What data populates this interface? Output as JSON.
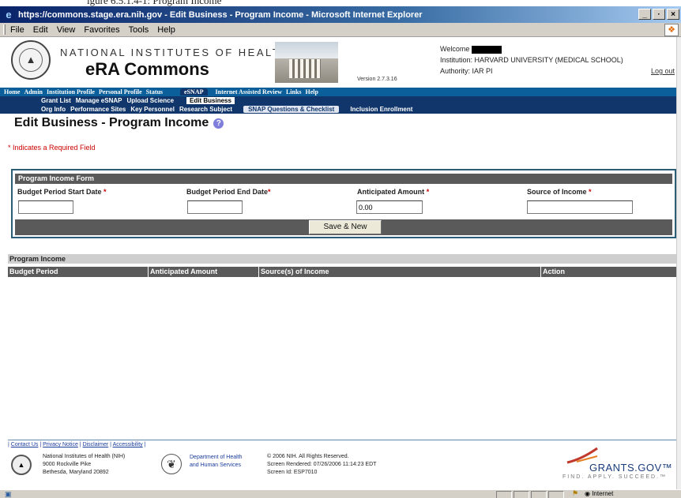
{
  "window": {
    "title": "https://commons.stage.era.nih.gov - Edit Business - Program Income - Microsoft Internet Explorer",
    "buttons": [
      "_",
      "·",
      "×"
    ]
  },
  "menubar": {
    "items": [
      "File",
      "Edit",
      "View",
      "Favorites",
      "Tools",
      "Help"
    ]
  },
  "header": {
    "org_name": "NATIONAL INSTITUTES OF HEALTH",
    "app_name": "eRA Commons",
    "version": "Version 2.7.3.16",
    "welcome_label": "Welcome",
    "institution": "Institution: HARVARD UNIVERSITY (MEDICAL SCHOOL)",
    "authority": "Authority:  IAR  PI",
    "logout": "Log out"
  },
  "nav": {
    "primary": [
      "Home",
      "Admin",
      "Institution Profile",
      "Personal Profile",
      "Status",
      "eSNAP",
      "Internet Assisted Review",
      "Links",
      "Help"
    ],
    "primary_active": "eSNAP",
    "secondary": [
      "Grant List",
      "Manage eSNAP",
      "Upload Science",
      "Edit Business"
    ],
    "secondary_active": "Edit Business",
    "tertiary": [
      "Org Info",
      "Performance Sites",
      "Key Personnel",
      "Research Subject",
      "SNAP Questions & Checklist",
      "Inclusion Enrollment"
    ],
    "tertiary_active": "SNAP Questions & Checklist"
  },
  "page": {
    "title": "Edit Business - Program Income",
    "required_note": "* Indicates a Required Field"
  },
  "form": {
    "header": "Program Income Form",
    "fields": {
      "start_date": {
        "label": "Budget Period Start Date",
        "value": ""
      },
      "end_date": {
        "label": "Budget Period End Date",
        "value": ""
      },
      "amount": {
        "label": "Anticipated Amount",
        "value": "0.00"
      },
      "source": {
        "label": "Source of Income",
        "value": ""
      }
    },
    "required_marker": "*",
    "save_button": "Save & New"
  },
  "program_income": {
    "header": "Program Income",
    "columns": [
      "Budget Period",
      "Anticipated Amount",
      "Source(s) of Income",
      "Action"
    ],
    "rows": []
  },
  "footer": {
    "links": [
      "Contact Us",
      "Privacy Notice",
      "Disclaimer",
      "Accessibility"
    ],
    "address": [
      "National Institutes of Health (NIH)",
      "9000 Rockville Pike",
      "Bethesda, Maryland 20892"
    ],
    "hhs": [
      "Department of Health",
      "and Human Services"
    ],
    "copyright": [
      "© 2006 NIH. All Rights Reserved.",
      "Screen Rendered: 07/26/2006 11:14:23 EDT",
      "Screen Id: ESP7010"
    ],
    "grants_name": "GRANTS.GOV™",
    "grants_tagline": "FIND. APPLY. SUCCEED.™"
  },
  "statusbar": {
    "zone": "Internet"
  }
}
